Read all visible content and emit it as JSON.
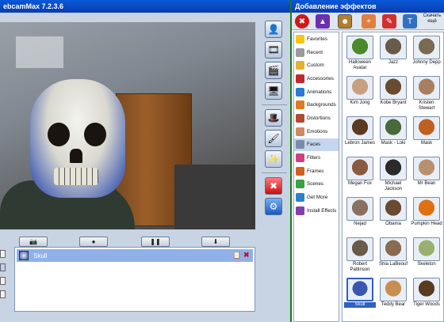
{
  "left_window": {
    "title": "ebcamMax 7.2.3.6",
    "active_effect": {
      "name": "Skull"
    }
  },
  "right_window": {
    "title": "Добавление эффектов",
    "download_label": "Скачать ещё"
  },
  "categories": [
    {
      "label": "Favorites",
      "icon": "star-icon",
      "color": "#f5c518"
    },
    {
      "label": "Recent",
      "icon": "clock-icon",
      "color": "#9a9a9a"
    },
    {
      "label": "Custom",
      "icon": "custom-icon",
      "color": "#e8b030"
    },
    {
      "label": "Accessories",
      "icon": "accessories-icon",
      "color": "#c0282a"
    },
    {
      "label": "Animations",
      "icon": "animations-icon",
      "color": "#2c7bd0"
    },
    {
      "label": "Backgrounds",
      "icon": "backgrounds-icon",
      "color": "#e07a20"
    },
    {
      "label": "Distortions",
      "icon": "distortions-icon",
      "color": "#b04a30"
    },
    {
      "label": "Emotions",
      "icon": "emotions-icon",
      "color": "#d08a60"
    },
    {
      "label": "Faces",
      "icon": "faces-icon",
      "color": "#7a8aa8",
      "selected": true
    },
    {
      "label": "Filters",
      "icon": "filters-icon",
      "color": "#d04080"
    },
    {
      "label": "Frames",
      "icon": "frames-icon",
      "color": "#d06020"
    },
    {
      "label": "Scenes",
      "icon": "scenes-icon",
      "color": "#3aa040"
    },
    {
      "label": "Get More",
      "icon": "globe-icon",
      "color": "#2a80d0"
    },
    {
      "label": "Install Effects",
      "icon": "install-icon",
      "color": "#8040b0"
    }
  ],
  "faces": [
    {
      "label": "Halloween Avatar",
      "color": "#4a8a2a"
    },
    {
      "label": "Jazz",
      "color": "#6a5a4a"
    },
    {
      "label": "Johnny Depp",
      "color": "#7a6a50"
    },
    {
      "label": "Kim Jong",
      "color": "#c8a080"
    },
    {
      "label": "Kobe Bryant",
      "color": "#6a4a30"
    },
    {
      "label": "Kristen Stewart",
      "color": "#a88060"
    },
    {
      "label": "Lebron James",
      "color": "#5a3a20"
    },
    {
      "label": "Mask - Loki",
      "color": "#4a6a3a"
    },
    {
      "label": "Mask",
      "color": "#c06020"
    },
    {
      "label": "Megan Fox",
      "color": "#8a5a40"
    },
    {
      "label": "Michael Jackson",
      "color": "#2a2a2a"
    },
    {
      "label": "Mr Bean",
      "color": "#b89070"
    },
    {
      "label": "Nejad",
      "color": "#8a7060"
    },
    {
      "label": "Obama",
      "color": "#6a4a30"
    },
    {
      "label": "Pumpkin Head",
      "color": "#e07010"
    },
    {
      "label": "Robert Pattinson",
      "color": "#6a5a4a"
    },
    {
      "label": "Shia LaBeouf",
      "color": "#8a6a50"
    },
    {
      "label": "Skeleton",
      "color": "#9ab070"
    },
    {
      "label": "Skull",
      "color": "#3a58b0",
      "selected": true
    },
    {
      "label": "Teddy Bear",
      "color": "#c89050"
    },
    {
      "label": "Tiger Woods",
      "color": "#5a3a20"
    }
  ]
}
